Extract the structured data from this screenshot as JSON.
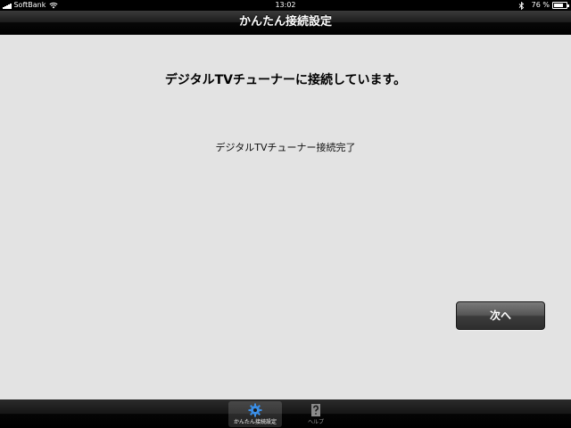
{
  "status_bar": {
    "carrier": "SoftBank",
    "time": "13:02",
    "battery_percent": "76 %",
    "battery_level": 0.76
  },
  "nav_bar": {
    "title": "かんたん接続設定"
  },
  "main": {
    "heading": "デジタルTVチューナーに接続しています。",
    "status_message": "デジタルTVチューナー接続完了",
    "next_button_label": "次へ"
  },
  "tab_bar": {
    "selected_index": 0,
    "tabs": [
      {
        "label": "かんたん接続設定",
        "icon": "gear-icon"
      },
      {
        "label": "ヘルプ",
        "icon": "help-icon"
      }
    ]
  },
  "colors": {
    "background": "#e3e3e3",
    "accent_blue": "#3a8ee6"
  }
}
